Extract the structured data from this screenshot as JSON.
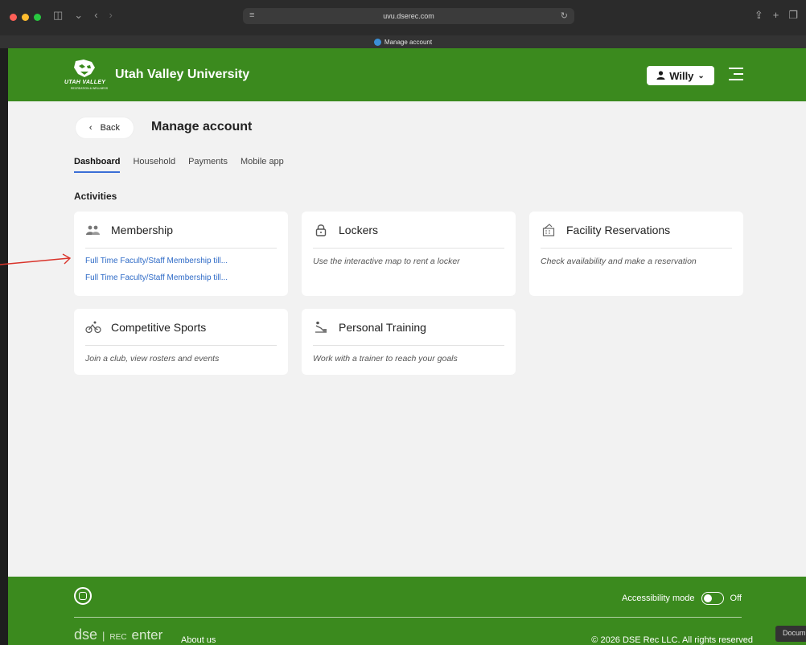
{
  "browser": {
    "url": "uvu.dserec.com",
    "tab_title": "Manage account",
    "doc_tab": "Docum"
  },
  "header": {
    "logo_text": "UTAH VALLEY",
    "logo_sub": "RECREATION & WELLNESS",
    "university": "Utah Valley University",
    "user_name": "Willy"
  },
  "nav": {
    "back_label": "Back",
    "page_title": "Manage account",
    "tabs": [
      {
        "label": "Dashboard",
        "active": true
      },
      {
        "label": "Household",
        "active": false
      },
      {
        "label": "Payments",
        "active": false
      },
      {
        "label": "Mobile app",
        "active": false
      }
    ]
  },
  "section_title": "Activities",
  "cards": {
    "membership": {
      "title": "Membership",
      "links": [
        "Full Time Faculty/Staff Membership till...",
        "Full Time Faculty/Staff Membership till..."
      ]
    },
    "lockers": {
      "title": "Lockers",
      "description": "Use the interactive map to rent a locker"
    },
    "facility": {
      "title": "Facility Reservations",
      "description": "Check availability and make a reservation"
    },
    "sports": {
      "title": "Competitive Sports",
      "description": "Join a club, view rosters and events"
    },
    "training": {
      "title": "Personal Training",
      "description": "Work with a trainer to reach your goals"
    }
  },
  "footer": {
    "accessibility_label": "Accessibility mode",
    "accessibility_state": "Off",
    "brand_dse": "dse",
    "brand_rec": "REC",
    "brand_center": "enter",
    "about": "About us",
    "copyright": "© 2026 DSE Rec LLC. All rights reserved"
  },
  "colors": {
    "brand_green": "#3b8a1e",
    "link_blue": "#2f6bc7",
    "annotation_red": "#d9342b"
  }
}
